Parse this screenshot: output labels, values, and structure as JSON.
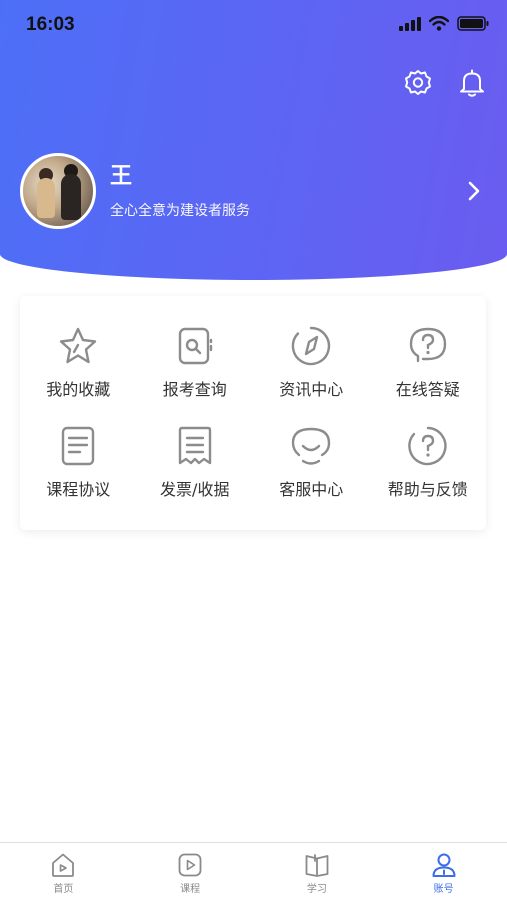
{
  "status_bar": {
    "time": "16:03"
  },
  "header": {
    "settings_icon": "gear-icon",
    "notification_icon": "bell-icon"
  },
  "profile": {
    "name": "王",
    "slogan": "全心全意为建设者服务"
  },
  "menu": {
    "items": [
      {
        "label": "我的收藏",
        "icon": "star-icon"
      },
      {
        "label": "报考查询",
        "icon": "search-doc-icon"
      },
      {
        "label": "资讯中心",
        "icon": "compass-icon"
      },
      {
        "label": "在线答疑",
        "icon": "question-chat-icon"
      },
      {
        "label": "课程协议",
        "icon": "document-icon"
      },
      {
        "label": "发票/收据",
        "icon": "receipt-icon"
      },
      {
        "label": "客服中心",
        "icon": "customer-service-icon"
      },
      {
        "label": "帮助与反馈",
        "icon": "help-icon"
      }
    ]
  },
  "tabbar": {
    "tabs": [
      {
        "label": "首页",
        "icon": "home-icon"
      },
      {
        "label": "课程",
        "icon": "play-icon"
      },
      {
        "label": "学习",
        "icon": "book-icon"
      },
      {
        "label": "账号",
        "icon": "user-icon",
        "active": true
      }
    ]
  },
  "colors": {
    "header_start": "#4d6ff7",
    "header_end": "#6a5cf0",
    "accent": "#3d6ee8",
    "icon_gray": "#8c8c8c"
  }
}
